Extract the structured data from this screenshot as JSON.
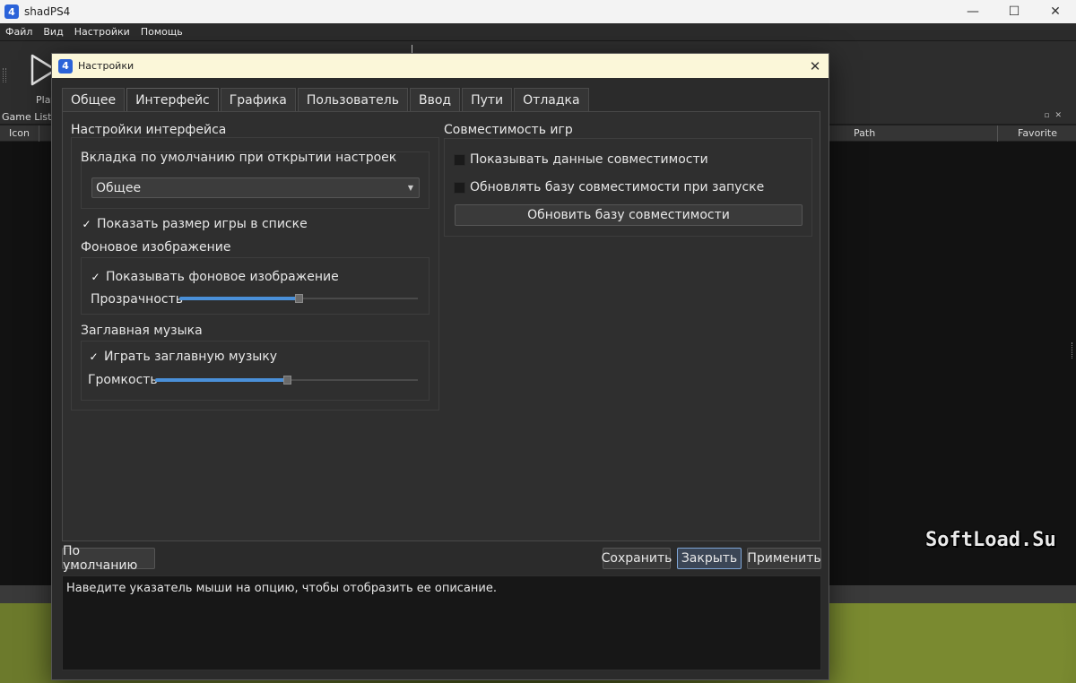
{
  "app": {
    "title": "shadPS4",
    "icon_text": "4"
  },
  "window_controls": {
    "minimize": "—",
    "maximize": "☐",
    "close": "✕"
  },
  "menu": [
    "Файл",
    "Вид",
    "Настройки",
    "Помощь"
  ],
  "toolbar": {
    "play_label": "Play"
  },
  "game_list": {
    "title": "Game List",
    "columns": {
      "icon": "Icon",
      "path": "Path",
      "favorite": "Favorite"
    }
  },
  "watermark": "SoftLoad.Su",
  "dialog": {
    "title": "Настройки",
    "close": "✕",
    "tabs": [
      "Общее",
      "Интерфейс",
      "Графика",
      "Пользователь",
      "Ввод",
      "Пути",
      "Отладка"
    ],
    "active_tab": "Интерфейс",
    "interface": {
      "group_title": "Настройки интерфейса",
      "default_tab_label": "Вкладка по умолчанию при открытии настроек",
      "default_tab_value": "Общее",
      "show_game_size": {
        "label": "Показать размер игры в списке",
        "checked": true
      },
      "background": {
        "title": "Фоновое изображение",
        "show_bg": {
          "label": "Показывать фоновое изображение",
          "checked": true
        },
        "opacity_label": "Прозрачность",
        "opacity_value": 0.5
      },
      "title_music": {
        "title": "Заглавная музыка",
        "play": {
          "label": "Играть заглавную музыку",
          "checked": true
        },
        "volume_label": "Громкость",
        "volume_value": 0.5
      }
    },
    "compat": {
      "group_title": "Совместимость игр",
      "show_data": {
        "label": "Показывать данные совместимости",
        "checked": false
      },
      "update_on_start": {
        "label": "Обновлять базу совместимости при запуске",
        "checked": false
      },
      "update_button": "Обновить базу совместимости"
    },
    "buttons": {
      "defaults": "По умолчанию",
      "save": "Сохранить",
      "close": "Закрыть",
      "apply": "Применить"
    },
    "description": "Наведите указатель мыши на опцию, чтобы отобразить ее описание."
  },
  "colors": {
    "accent": "#4a90d9",
    "dialog_title_bg": "#fbf7d9"
  }
}
